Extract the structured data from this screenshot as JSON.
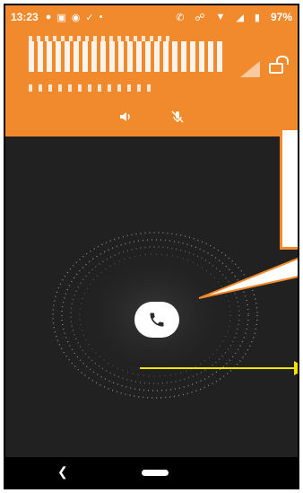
{
  "status_bar": {
    "time": "13:23",
    "battery": "97%",
    "left_icons": [
      "chat-icon",
      "image-icon",
      "robot-icon",
      "check-icon",
      "dot-icon"
    ],
    "right_icons": [
      "phone-forward-icon",
      "vibrate-icon",
      "wifi-icon",
      "cell-icon",
      "battery-icon"
    ]
  },
  "header": {
    "caller_name": "",
    "caller_detail": "",
    "background_color": "#f18a2d"
  },
  "controls": {
    "speaker_icon": "speaker-icon",
    "mute_icon": "mic-off-icon"
  },
  "call_action": {
    "icon": "phone-icon"
  },
  "colors": {
    "accent": "#f18a2d",
    "background": "#212121",
    "annotation_arrow": "#f2e600"
  }
}
